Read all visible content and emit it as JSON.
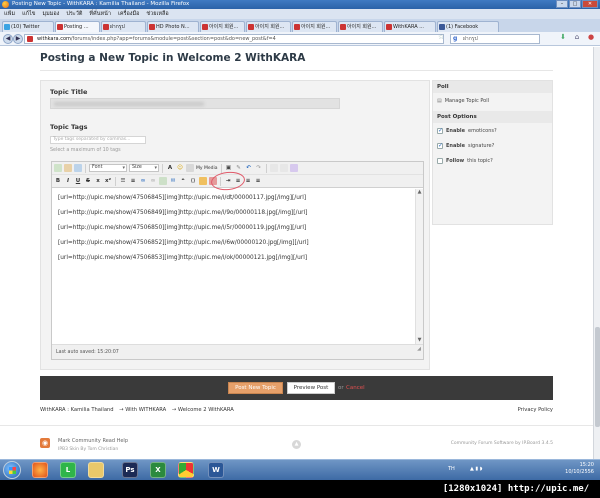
{
  "browser": {
    "title": "Posting New Topic - WithKARA : Kamilia Thailand - Mozilla Firefox",
    "menu": [
      "แฟ้ม",
      "แก้ไข",
      "มุมมอง",
      "ประวัติ",
      "ที่คั่นหน้า",
      "เครื่องมือ",
      "ช่วยเหลือ"
    ],
    "tabs": [
      {
        "label": "(10) Twitter",
        "color": "#3aa3e3"
      },
      {
        "label": "Posting ...",
        "color": "#c33",
        "active": true
      },
      {
        "label": "ฝากรูป",
        "color": "#c33"
      },
      {
        "label": "HD Photo N...",
        "color": "#c33"
      },
      {
        "label": "아이지 회원...",
        "color": "#c33"
      },
      {
        "label": "아이지 회원...",
        "color": "#c33"
      },
      {
        "label": "아이지 회원...",
        "color": "#c33"
      },
      {
        "label": "아이지 회원...",
        "color": "#c33"
      },
      {
        "label": "WithKARA ...",
        "color": "#c33"
      },
      {
        "label": "(1) Facebook",
        "color": "#3b5998"
      }
    ],
    "url_site": "withkara.com",
    "url_path": "/forums/index.php?app=forums&module=post&section=post&do=new_post&f=4",
    "search_text": "ฝากรูป"
  },
  "page": {
    "title": "Posting a New Topic in Welcome 2 WithKARA",
    "topic_title_label": "Topic Title",
    "topic_tags_label": "Topic Tags",
    "tags_placeholder": "Type tags separated by commas...",
    "tags_note": "Select a maximum of 10 tags"
  },
  "editor": {
    "font_select": "Font",
    "size_select": "Size",
    "my_media": "My Media",
    "lines": [
      "[url=http://upic.me/show/47506845][img]http://upic.me/i/dt/00000117.jpg[/img][/url]",
      "[url=http://upic.me/show/47506849][img]http://upic.me/i/9o/00000118.jpg[/img][/url]",
      "[url=http://upic.me/show/47506850][img]http://upic.me/i/5r/00000119.jpg[/img][/url]",
      "[url=http://upic.me/show/47506852][img]http://upic.me/i/6w/00000120.jpg[/img][/url]",
      "[url=http://upic.me/show/47506853][img]http://upic.me/i/ok/00000121.jpg[/img][/url]"
    ],
    "autosave": "Last auto saved: 15:20:07"
  },
  "sidebar": {
    "poll_head": "Poll",
    "manage_poll": "Manage Topic Poll",
    "options_head": "Post Options",
    "enable_label": "Enable",
    "emoticons": "emoticons?",
    "signature": "signature?",
    "follow_label": "Follow",
    "follow_rest": "this topic?"
  },
  "actions": {
    "post": "Post New Topic",
    "preview": "Preview Post",
    "or": "or",
    "cancel": "Cancel"
  },
  "footer": {
    "crumbs": [
      "WithKARA : Kamilia Thailand",
      "→ With WITHKARA",
      "→ Welcome 2 WithKARA"
    ],
    "privacy": "Privacy Policy",
    "links": "Mark Community Read   Help",
    "skin": "IPB3 Skin By Tom Christian",
    "powered": "Community Forum Software by IP.Board 3.4.5"
  },
  "taskbar": {
    "lang": "TH",
    "time": "15:20",
    "date": "10/10/2556"
  },
  "watermark": "[1280x1024] http://upic.me/"
}
